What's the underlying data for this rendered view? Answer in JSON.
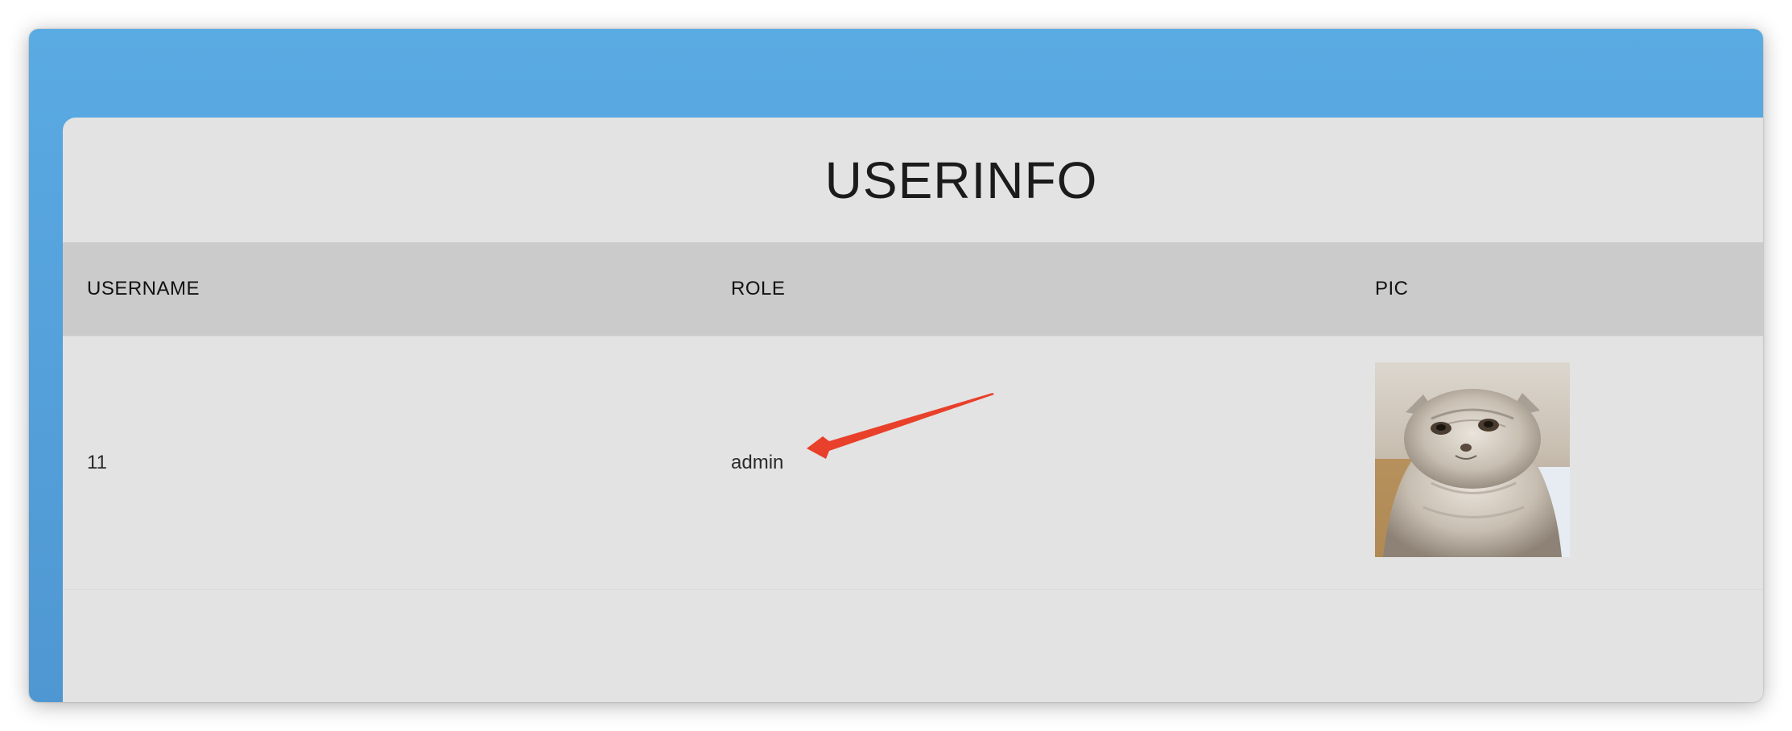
{
  "page": {
    "title": "USERINFO"
  },
  "table": {
    "headers": [
      "USERNAME",
      "ROLE",
      "PIC"
    ],
    "rows": [
      {
        "username": "11",
        "role": "admin",
        "pic": "cat-avatar-image"
      }
    ]
  },
  "annotation": {
    "type": "arrow",
    "color": "#e8402a",
    "points_to": "admin"
  },
  "colors": {
    "header_bar": "#5aaae3",
    "panel_bg": "#e3e3e3",
    "table_header_bg": "#cbcbcb"
  }
}
